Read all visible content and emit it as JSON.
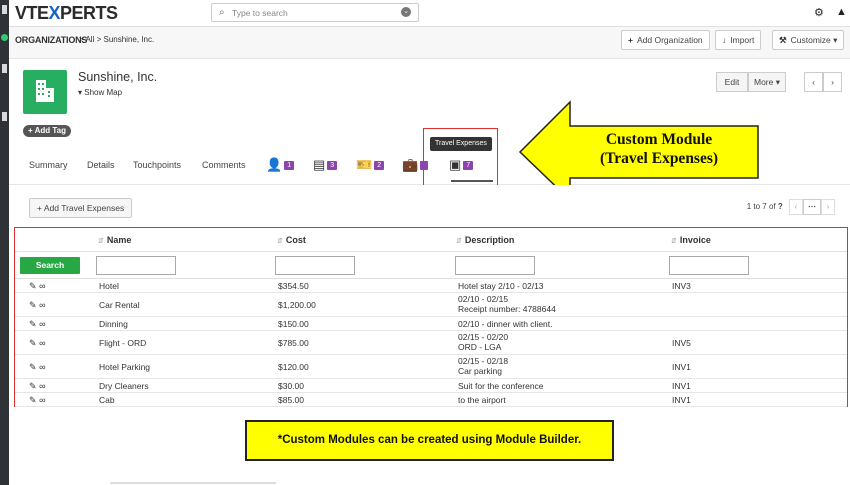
{
  "app": {
    "logo_a": "VTE",
    "logo_x": "X",
    "logo_b": "PERTS"
  },
  "search": {
    "placeholder": "Type to search"
  },
  "breadcrumb": {
    "module": "ORGANIZATIONS",
    "sep1": ">",
    "filter": "All",
    "sep2": ">",
    "record": "Sunshine, Inc."
  },
  "actions": {
    "add_org": "Add Organization",
    "import": "Import",
    "customize": "Customize"
  },
  "record": {
    "name": "Sunshine, Inc.",
    "show_map": "Show Map",
    "add_tag": "Add Tag",
    "edit": "Edit",
    "more": "More"
  },
  "tabs": {
    "summary": "Summary",
    "details": "Details",
    "touchpoints": "Touchpoints",
    "comments": "Comments",
    "icons": [
      {
        "name": "contacts-tab-icon",
        "glyph": "👤",
        "count": "1"
      },
      {
        "name": "documents-tab-icon",
        "glyph": "▤",
        "count": "3"
      },
      {
        "name": "tickets-tab-icon",
        "glyph": "🎫",
        "count": "2"
      },
      {
        "name": "products-tab-icon",
        "glyph": "💼",
        "count": ""
      },
      {
        "name": "travel-expenses-tab-icon",
        "glyph": "▣",
        "count": "7"
      }
    ],
    "tooltip": "Travel Expenses"
  },
  "callout": {
    "line1": "Custom Module",
    "line2": "(Travel Expenses)"
  },
  "related": {
    "add_button": "Add Travel Expenses",
    "pager_prefix": "1 to 7",
    "pager_of": "of",
    "pager_q": "?",
    "search_button": "Search",
    "columns": [
      "Name",
      "Cost",
      "Description",
      "Invoice"
    ],
    "rows": [
      {
        "name": "Hotel",
        "cost": "$354.50",
        "desc1": "Hotel stay 2/10 - 02/13",
        "desc2": "",
        "invoice": "INV3"
      },
      {
        "name": "Car Rental",
        "cost": "$1,200.00",
        "desc1": "02/10 - 02/15",
        "desc2": "Receipt number: 4788644",
        "invoice": ""
      },
      {
        "name": "Dinning",
        "cost": "$150.00",
        "desc1": "02/10 - dinner with client.",
        "desc2": "",
        "invoice": ""
      },
      {
        "name": "Flight - ORD",
        "cost": "$785.00",
        "desc1": "02/15 - 02/20",
        "desc2": "ORD - LGA",
        "invoice": "INV5"
      },
      {
        "name": "Hotel Parking",
        "cost": "$120.00",
        "desc1": "02/15 - 02/18",
        "desc2": "Car parking",
        "invoice": "INV1"
      },
      {
        "name": "Dry Cleaners",
        "cost": "$30.00",
        "desc1": "Suit for the conference",
        "desc2": "",
        "invoice": "INV1"
      },
      {
        "name": "Cab",
        "cost": "$85.00",
        "desc1": "to the airport",
        "desc2": "",
        "invoice": "INV1"
      }
    ]
  },
  "note": "*Custom Modules can be created using Module Builder.",
  "colors": {
    "accent_green": "#27a844",
    "badge_purple": "#8e44ad",
    "highlight_red": "#e03030",
    "callout_yellow": "#ffff00"
  }
}
